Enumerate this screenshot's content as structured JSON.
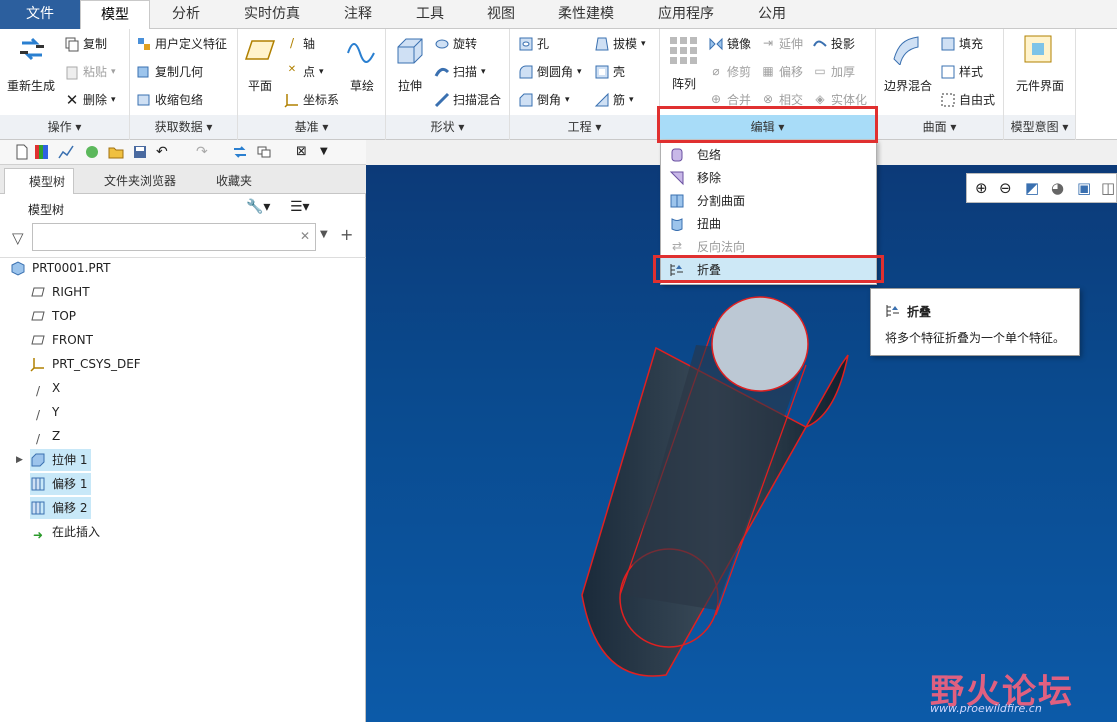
{
  "tabs": [
    "文件",
    "模型",
    "分析",
    "实时仿真",
    "注释",
    "工具",
    "视图",
    "柔性建模",
    "应用程序",
    "公用"
  ],
  "ribbon": {
    "ops": {
      "regen": "重新生成",
      "copy": "复制",
      "paste": "粘贴",
      "delete": "删除",
      "label": "操作"
    },
    "getdata": {
      "udf": "用户定义特征",
      "copygeom": "复制几何",
      "shrinkwrap": "收缩包络",
      "label": "获取数据"
    },
    "datum": {
      "plane": "平面",
      "axis": "轴",
      "point": "点",
      "csys": "坐标系",
      "sketch": "草绘",
      "label": "基准"
    },
    "shape": {
      "extrude": "拉伸",
      "revolve": "旋转",
      "sweep": "扫描",
      "sweepblend": "扫描混合",
      "label": "形状"
    },
    "eng": {
      "hole": "孔",
      "round": "倒圆角",
      "chamfer": "倒角",
      "draft": "拔模",
      "shell": "壳",
      "rib": "筋",
      "label": "工程"
    },
    "edit": {
      "pattern": "阵列",
      "mirror": "镜像",
      "extend": "延伸",
      "project": "投影",
      "trim": "修剪",
      "offset": "偏移",
      "thicken": "加厚",
      "merge": "合并",
      "intersect": "相交",
      "solidify": "实体化",
      "label": "编辑"
    },
    "surface": {
      "boundary": "边界混合",
      "fill": "填充",
      "style": "样式",
      "freeform": "自由式",
      "label": "曲面"
    },
    "intent": {
      "component": "元件界面",
      "label": "模型意图"
    }
  },
  "left_tabs": [
    "模型树",
    "文件夹浏览器",
    "收藏夹"
  ],
  "tree": {
    "title": "模型树",
    "items": [
      "PRT0001.PRT",
      "RIGHT",
      "TOP",
      "FRONT",
      "PRT_CSYS_DEF",
      "X",
      "Y",
      "Z",
      "拉伸 1",
      "偏移 1",
      "偏移 2",
      "在此插入"
    ]
  },
  "dropdown": [
    "包络",
    "移除",
    "分割曲面",
    "扭曲",
    "反向法向",
    "折叠"
  ],
  "tooltip": {
    "title": "折叠",
    "desc": "将多个特征折叠为一个单个特征。"
  },
  "watermark": {
    "text": "野火论坛",
    "url": "www.proewildfire.cn"
  },
  "colors": {
    "accent": "#2c5f9e",
    "highlight": "#c8e8f8",
    "redbox": "#e03030",
    "viewport": "#0a4a8e"
  }
}
